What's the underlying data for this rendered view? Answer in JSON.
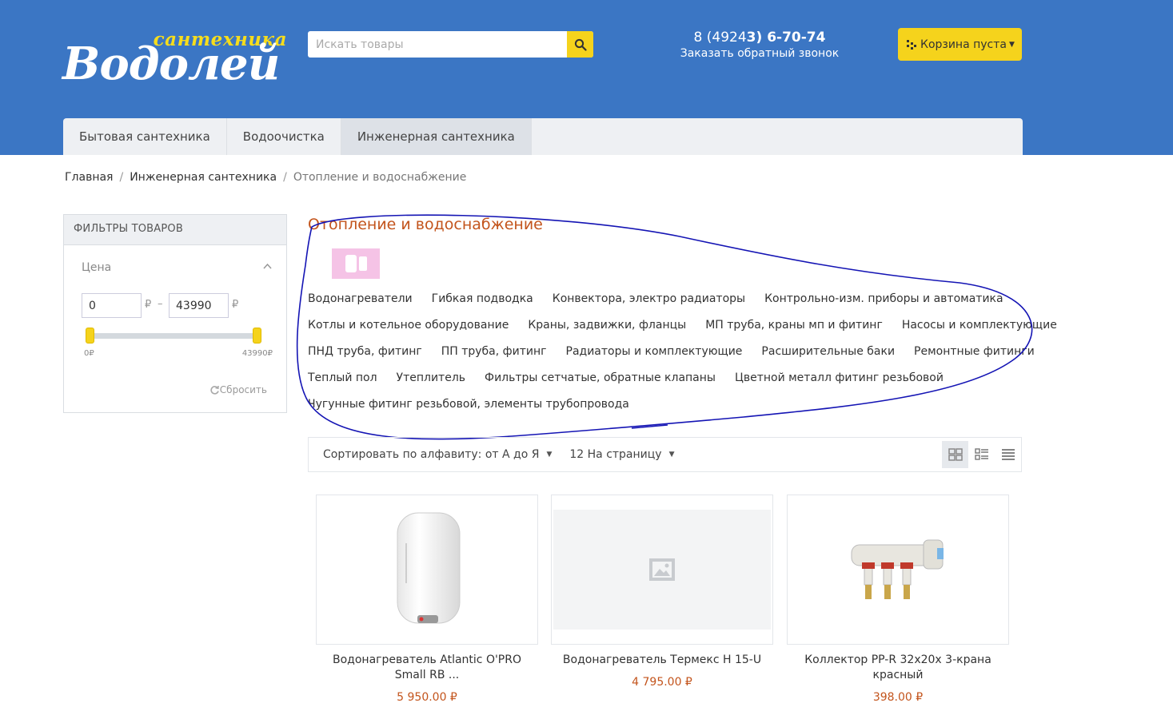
{
  "header": {
    "logo_top": "сантехника",
    "logo_main": "Водолей",
    "search_placeholder": "Искать товары",
    "phone_prefix": "8 (4924",
    "phone_bold": "3) 6-70-74",
    "callback": "Заказать обратный звонок",
    "cart": "Корзина пуста"
  },
  "nav": {
    "tabs": [
      "Бытовая сантехника",
      "Водоочистка",
      "Инженерная сантехника"
    ],
    "active": "Инженерная сантехника"
  },
  "breadcrumb": [
    "Главная",
    "Инженерная сантехника",
    "Отопление и водоснабжение"
  ],
  "filter": {
    "title": "ФИЛЬТРЫ ТОВАРОВ",
    "price_label": "Цена",
    "min": "0",
    "max": "43990",
    "currency": "₽",
    "range_min_label": "0₽",
    "range_max_label": "43990₽",
    "reset": "Сбросить"
  },
  "category": {
    "title": "Отопление и водоснабжение",
    "rows": [
      [
        "Водонагреватели",
        "Гибкая подводка",
        "Конвектора, электро радиаторы",
        "Контрольно-изм. приборы и автоматика"
      ],
      [
        "Котлы и котельное оборудование",
        "Краны, задвижки, фланцы",
        "МП труба, краны мп и фитинг",
        "Насосы и комплектующие"
      ],
      [
        "ПНД труба, фитинг",
        "ПП труба, фитинг",
        "Радиаторы и комплектующие",
        "Расширительные баки",
        "Ремонтные фитинги"
      ],
      [
        "Теплый пол",
        "Утеплитель",
        "Фильтры сетчатые, обратные клапаны",
        "Цветной металл фитинг резьбовой"
      ],
      [
        "Чугунные фитинг резьбовой, элементы трубопровода"
      ]
    ]
  },
  "toolbar": {
    "sort": "Сортировать по алфавиту: от А до Я",
    "per_page": "12 На страницу"
  },
  "products": [
    {
      "name": "Водонагреватель Atlantic O'PRO Small RB ...",
      "price": "5 950.00 ₽"
    },
    {
      "name": "Водонагреватель Термекс H 15-U",
      "price": "4 795.00 ₽"
    },
    {
      "name": "Коллектор PP-R 32x20x 3-крана красный",
      "price": "398.00 ₽"
    }
  ],
  "colors": {
    "header_bg": "#3b76c4",
    "accent_yellow": "#f5d31c",
    "price_orange": "#c3541c",
    "annotation_blue": "#1010b4"
  }
}
